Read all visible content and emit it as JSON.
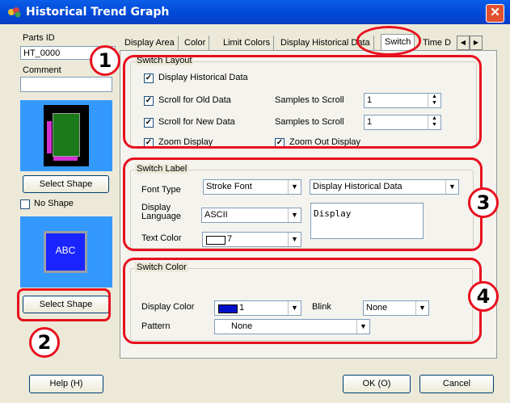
{
  "window": {
    "title": "Historical Trend Graph"
  },
  "left_panel": {
    "parts_id_label": "Parts ID",
    "parts_id_value": "HT_0000",
    "comment_label": "Comment",
    "comment_value": "",
    "select_shape_1": "Select Shape",
    "no_shape_label": "No Shape",
    "abc_preview": "ABC",
    "select_shape_2": "Select Shape"
  },
  "tabs": [
    "Display Area",
    "Color",
    "Limit Colors",
    "Display Historical Data",
    "Switch",
    "Time D"
  ],
  "switch_layout": {
    "title": "Switch Layout",
    "display_historical": "Display Historical Data",
    "scroll_old": "Scroll for Old Data",
    "samples_old_label": "Samples to Scroll",
    "samples_old_value": "1",
    "scroll_new": "Scroll for New Data",
    "samples_new_label": "Samples to Scroll",
    "samples_new_value": "1",
    "zoom_display": "Zoom Display",
    "zoom_out_display": "Zoom Out Display"
  },
  "switch_label": {
    "title": "Switch Label",
    "font_type_label": "Font Type",
    "font_type_value": "Stroke Font",
    "label_select_value": "Display Historical Data",
    "display_lang_label_1": "Display",
    "display_lang_label_2": "Language",
    "display_lang_value": "ASCII",
    "text_area_value": "Display",
    "text_color_label": "Text Color",
    "text_color_value": "7"
  },
  "switch_color": {
    "title": "Switch Color",
    "display_color_label": "Display Color",
    "display_color_value": "1",
    "blink_label": "Blink",
    "blink_value": "None",
    "pattern_label": "Pattern",
    "pattern_value": "None"
  },
  "footer": {
    "help": "Help (H)",
    "ok": "OK (O)",
    "cancel": "Cancel"
  },
  "callouts": [
    "1",
    "2",
    "3",
    "4"
  ],
  "colors": {
    "accent_red": "#e8101e",
    "title_blue": "#0047d6",
    "preview_blue": "#1a4cff"
  }
}
